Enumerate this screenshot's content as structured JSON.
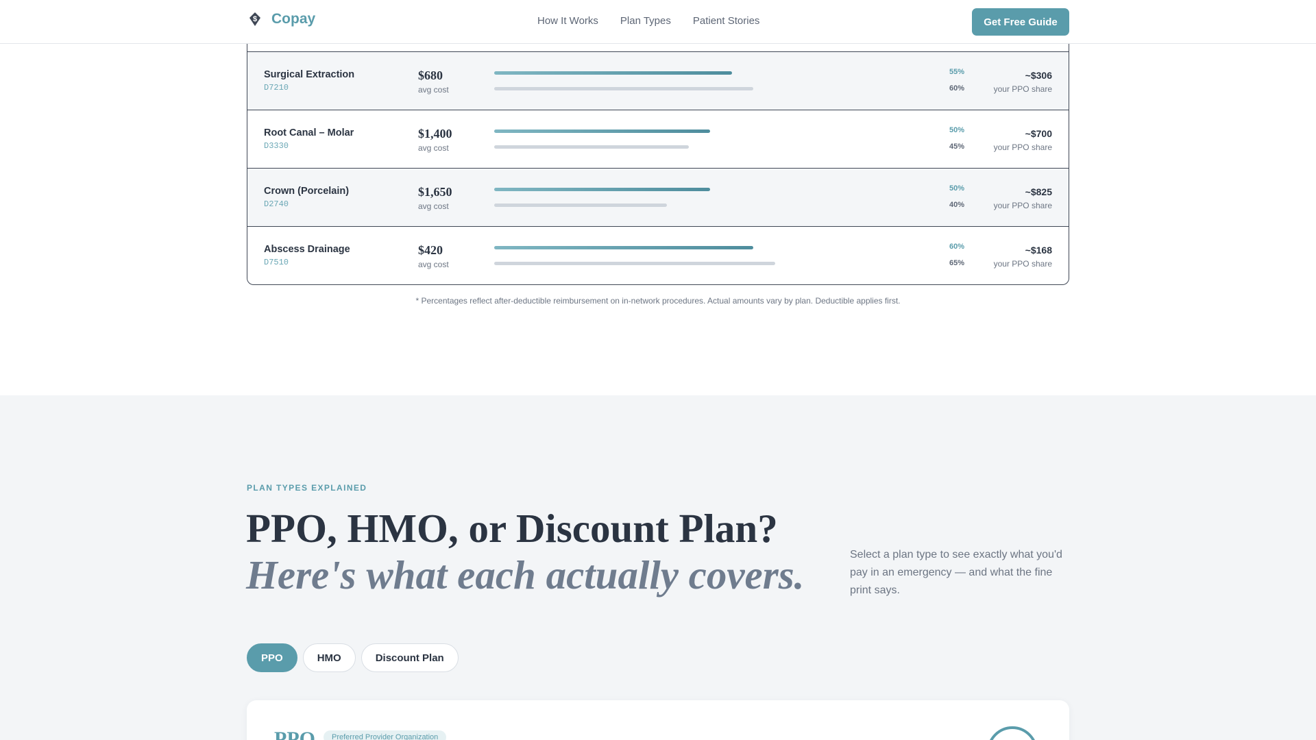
{
  "header": {
    "brand_name": "Copay",
    "nav": [
      "How It Works",
      "Plan Types",
      "Patient Stories"
    ],
    "cta_label": "Get Free Guide"
  },
  "procedures": [
    {
      "name": "Surgical Extraction",
      "code": "D7210",
      "cost": "$680",
      "cost_label": "avg cost",
      "ppo_pct_label": "55%",
      "other_pct_label": "60%",
      "ppo_pct": 55,
      "other_pct": 60,
      "share": "~$306",
      "share_label": "your PPO share"
    },
    {
      "name": "Root Canal – Molar",
      "code": "D3330",
      "cost": "$1,400",
      "cost_label": "avg cost",
      "ppo_pct_label": "50%",
      "other_pct_label": "45%",
      "ppo_pct": 50,
      "other_pct": 45,
      "share": "~$700",
      "share_label": "your PPO share"
    },
    {
      "name": "Crown (Porcelain)",
      "code": "D2740",
      "cost": "$1,650",
      "cost_label": "avg cost",
      "ppo_pct_label": "50%",
      "other_pct_label": "40%",
      "ppo_pct": 50,
      "other_pct": 40,
      "share": "~$825",
      "share_label": "your PPO share"
    },
    {
      "name": "Abscess Drainage",
      "code": "D7510",
      "cost": "$420",
      "cost_label": "avg cost",
      "ppo_pct_label": "60%",
      "other_pct_label": "65%",
      "ppo_pct": 60,
      "other_pct": 65,
      "share": "~$168",
      "share_label": "your PPO share"
    }
  ],
  "footnote": "* Percentages reflect after-deductible reimbursement on in-network procedures. Actual amounts vary by plan. Deductible applies first.",
  "plans": {
    "eyebrow": "PLAN TYPES EXPLAINED",
    "headline": "PPO, HMO, or Discount Plan?",
    "subhead": "Here's what each actually covers.",
    "intro": "Select a plan type to see exactly what you'd pay in an emergency — and what the fine print says.",
    "tabs": [
      "PPO",
      "HMO",
      "Discount Plan"
    ],
    "active_tab": "PPO",
    "card_title": "PPO",
    "card_badge": "Preferred Provider Organization"
  },
  "colors": {
    "accent": "#5a9cab",
    "text": "#2b3442",
    "muted": "#6c7583"
  }
}
